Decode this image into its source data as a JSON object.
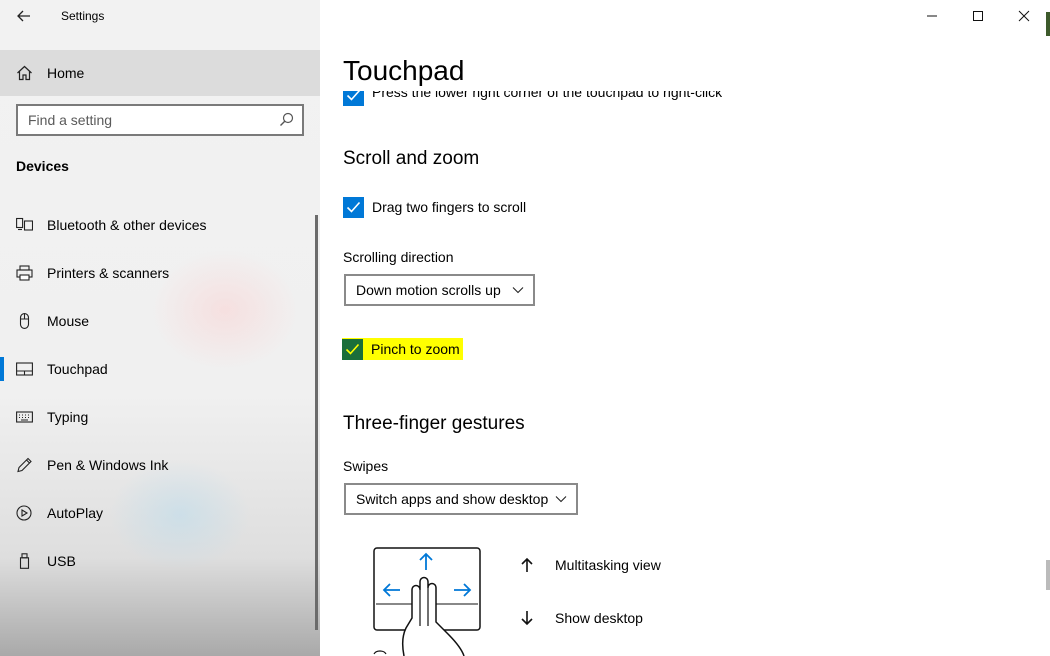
{
  "window": {
    "title": "Settings"
  },
  "sidebar": {
    "home_label": "Home",
    "search_placeholder": "Find a setting",
    "section_label": "Devices",
    "items": [
      {
        "label": "Bluetooth & other devices",
        "icon": "bluetooth-devices-icon",
        "selected": false
      },
      {
        "label": "Printers & scanners",
        "icon": "printer-icon",
        "selected": false
      },
      {
        "label": "Mouse",
        "icon": "mouse-icon",
        "selected": false
      },
      {
        "label": "Touchpad",
        "icon": "touchpad-icon",
        "selected": true
      },
      {
        "label": "Typing",
        "icon": "keyboard-icon",
        "selected": false
      },
      {
        "label": "Pen & Windows Ink",
        "icon": "pen-icon",
        "selected": false
      },
      {
        "label": "AutoPlay",
        "icon": "autoplay-icon",
        "selected": false
      },
      {
        "label": "USB",
        "icon": "usb-icon",
        "selected": false
      }
    ]
  },
  "main": {
    "page_title": "Touchpad",
    "clipped_option": {
      "label": "Press the lower right corner of the touchpad to right-click",
      "checked": true
    },
    "scroll_zoom": {
      "heading": "Scroll and zoom",
      "drag_two_fingers": {
        "label": "Drag two fingers to scroll",
        "checked": true
      },
      "scrolling_direction_label": "Scrolling direction",
      "scrolling_direction_value": "Down motion scrolls up",
      "pinch_to_zoom": {
        "label": "Pinch to zoom",
        "checked": true,
        "highlighted": true
      }
    },
    "three_finger": {
      "heading": "Three-finger gestures",
      "swipes_label": "Swipes",
      "swipes_value": "Switch apps and show desktop",
      "gesture_up_label": "Multitasking view",
      "gesture_down_label": "Show desktop"
    }
  },
  "colors": {
    "accent": "#0078d7",
    "highlight": "#ffff00",
    "sidebar_bg": "#f2f2f2",
    "selected_home_bg": "#dcdcdc"
  }
}
